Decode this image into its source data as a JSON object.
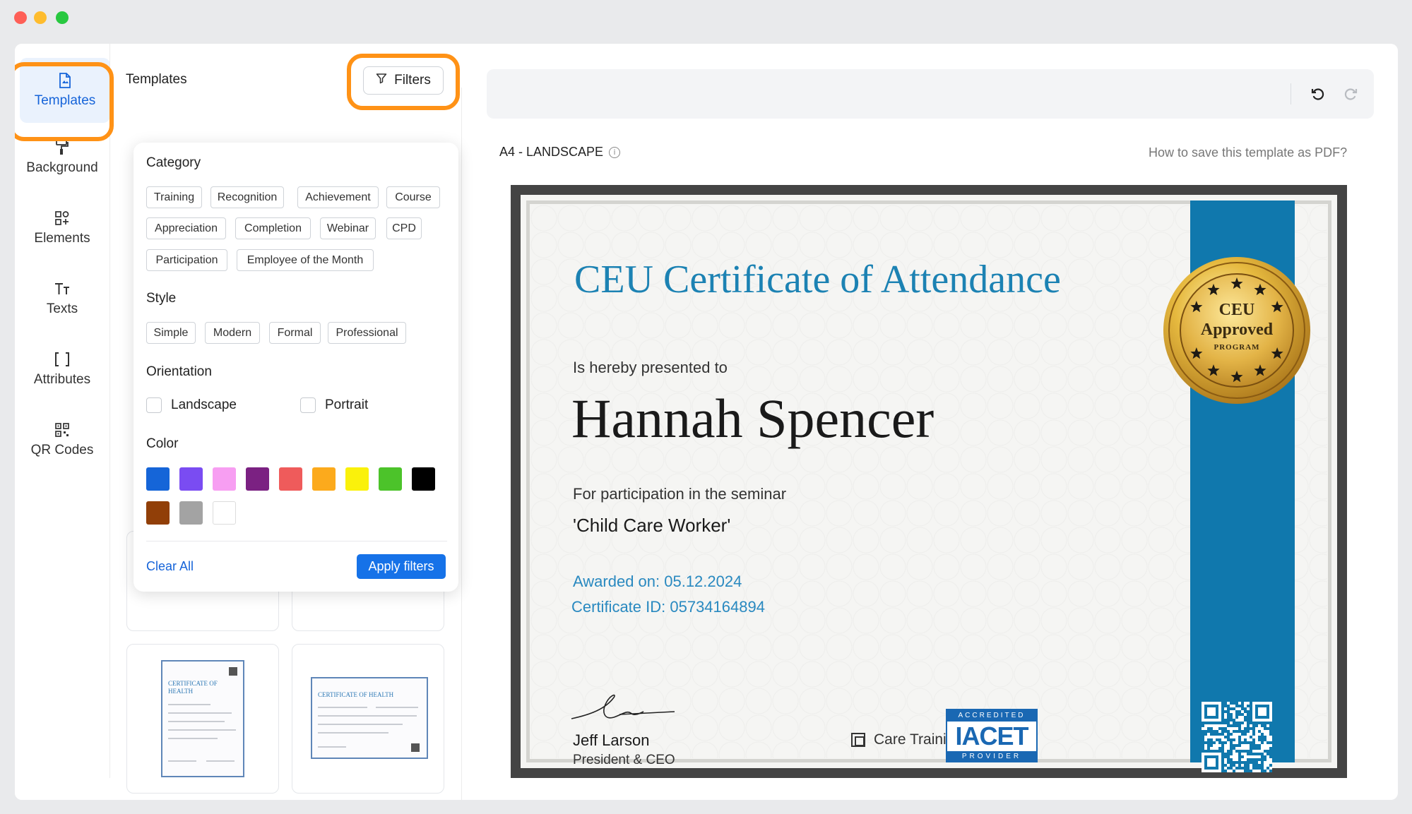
{
  "sidebar": {
    "items": [
      {
        "label": "Templates",
        "icon": "file-icon"
      },
      {
        "label": "Background",
        "icon": "paint-roller-icon"
      },
      {
        "label": "Elements",
        "icon": "shapes-icon"
      },
      {
        "label": "Texts",
        "icon": "text-icon"
      },
      {
        "label": "Attributes",
        "icon": "brackets-icon"
      },
      {
        "label": "QR Codes",
        "icon": "qr-code-icon"
      }
    ]
  },
  "templates_panel": {
    "title": "Templates",
    "filters_label": "Filters"
  },
  "filters": {
    "category_heading": "Category",
    "categories": [
      "Training",
      "Recognition",
      "Achievement",
      "Course",
      "Appreciation",
      "Completion",
      "Webinar",
      "CPD",
      "Participation",
      "Employee of the Month"
    ],
    "style_heading": "Style",
    "styles": [
      "Simple",
      "Modern",
      "Formal",
      "Professional"
    ],
    "orientation_heading": "Orientation",
    "orientations": [
      "Landscape",
      "Portrait"
    ],
    "color_heading": "Color",
    "colors": [
      "#1565d8",
      "#7a4cf2",
      "#f79ef2",
      "#7b2182",
      "#ef5b5b",
      "#fcaa1c",
      "#faf10b",
      "#4cc32a",
      "#000000",
      "#913f08",
      "#a3a3a3",
      "#ffffff"
    ],
    "clear_label": "Clear All",
    "apply_label": "Apply filters"
  },
  "thumbnails": [
    {
      "title": "CERTIFICATE OF HEALTH"
    },
    {
      "title": "CERTIFICATE OF HEALTH"
    }
  ],
  "canvas": {
    "page_size": "A4 - LANDSCAPE",
    "save_pdf_link": "How to save this template as PDF?"
  },
  "certificate": {
    "title": "CEU Certificate of Attendance",
    "presented": "Is hereby presented to",
    "recipient": "Hannah Spencer",
    "for_text": "For participation in the seminar",
    "seminar": "'Child Care Worker'",
    "awarded": "Awarded on: 05.12.2024",
    "certificate_id": "Certificate ID: 05734164894",
    "signer_name": "Jeff Larson",
    "signer_role": "President & CEO",
    "organization": "Care Training Solutions",
    "seal": {
      "line1": "CEU",
      "line2": "Approved",
      "line3": "PROGRAM"
    },
    "accreditation": {
      "top": "ACCREDITED",
      "middle": "IACET",
      "bottom": "PROVIDER"
    },
    "colors": {
      "title": "#1c82b3",
      "ribbon": "#1078ad",
      "link": "#2989c0"
    }
  },
  "accent_colors": {
    "highlight": "#ff9216",
    "primary": "#1672e8"
  }
}
